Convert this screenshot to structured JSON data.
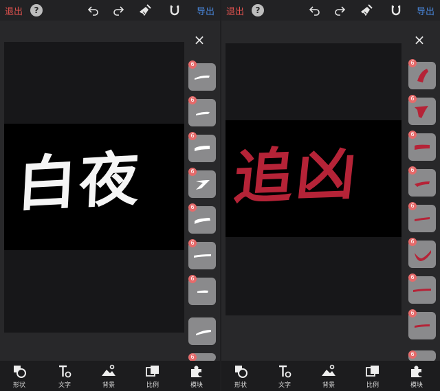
{
  "toolbar": {
    "exit_label": "退出",
    "help_label": "?",
    "export_label": "导出",
    "icons": [
      "undo-icon",
      "redo-icon",
      "clear-brush-icon",
      "magnet-icon"
    ]
  },
  "close_label": "×",
  "left": {
    "text": "白夜",
    "text_color": "#f5f5f5",
    "tile_badge": "6"
  },
  "right": {
    "text": "追凶",
    "text_color": "#b52337",
    "tile_badge": "6"
  },
  "bottom_tabs": [
    {
      "label": "形状",
      "icon": "shape-icon"
    },
    {
      "label": "文字",
      "icon": "text-icon"
    },
    {
      "label": "背景",
      "icon": "background-icon"
    },
    {
      "label": "比例",
      "icon": "ratio-icon"
    },
    {
      "label": "模块",
      "icon": "module-icon"
    }
  ]
}
